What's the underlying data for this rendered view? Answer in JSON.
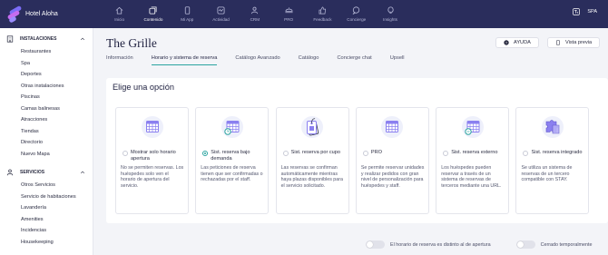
{
  "brand": {
    "name": "Hotel Aloha"
  },
  "nav": [
    {
      "label": "Inicio",
      "icon": "home-icon",
      "active": false
    },
    {
      "label": "Contenido",
      "icon": "content-icon",
      "active": true
    },
    {
      "label": "Mi App",
      "icon": "phone-icon",
      "active": false
    },
    {
      "label": "Actividad",
      "icon": "activity-icon",
      "active": false
    },
    {
      "label": "CRM",
      "icon": "users-icon",
      "active": false
    },
    {
      "label": "PRO",
      "icon": "pro-icon",
      "active": false
    },
    {
      "label": "Feedback",
      "icon": "thumbs-up-icon",
      "active": false
    },
    {
      "label": "Concierge",
      "icon": "chat-icon",
      "active": false
    },
    {
      "label": "Insights",
      "icon": "lightbulb-icon",
      "active": false
    }
  ],
  "top_right": {
    "lang": "SPA"
  },
  "sidebar": {
    "sections": [
      {
        "title": "INSTALACIONES",
        "items": [
          "Restaurantes",
          "Spa",
          "Deportes",
          "Otras instalaciones",
          "Piscinas",
          "Camas balinesas",
          "Atracciones",
          "Tiendas",
          "Directorio",
          "Nuevo Mapa"
        ]
      },
      {
        "title": "SERVICIOS",
        "items": [
          "Otros Servicios",
          "Servicio de habitaciones",
          "Lavandería",
          "Amenities",
          "Incidencias",
          "Housekeeping"
        ]
      }
    ]
  },
  "page": {
    "title": "The Grille",
    "help_label": "AYUDA",
    "preview_label": "Vista previa",
    "tabs": [
      "Información",
      "Horario y sistema de reserva",
      "Catálogo Avanzado",
      "Catálogo",
      "Concierge chat",
      "Upsell"
    ],
    "active_tab": 1
  },
  "card": {
    "title": "Elige una opción",
    "options": [
      {
        "label": "Mostrar solo horario apertura",
        "desc": "No se permiten reservas. Los huéspedes solo ven el horario de apertura del servicio.",
        "checked": false
      },
      {
        "label": "Sist. reserva bajo demanda",
        "desc": "Las peticiones de reserva tienen que ser confirmadas o rechazadas por el staff.",
        "checked": true
      },
      {
        "label": "Sist. reserva por cupo",
        "desc": "Las reservas se confirman automáticamente mientras haya plazas disponibles para el servicio solicitado.",
        "checked": false
      },
      {
        "label": "PRO",
        "desc": "Se permite reservar unidades y realizar pedidos con gran nivel de personalización para huéspedes y staff.",
        "checked": false
      },
      {
        "label": "Sist. reserva externo",
        "desc": "Los huéspedes pueden reservar a través de un sistema de reservas de terceros mediante una URL.",
        "checked": false
      },
      {
        "label": "Sist. reserva integrado",
        "desc": "Se utiliza un sistema de reservas de un tercero compatible con STAY.",
        "checked": false
      }
    ]
  },
  "toggles": [
    {
      "label": "El horario de reserva es distinto al de apertura",
      "on": false
    },
    {
      "label": "Cerrado temporalmente",
      "on": false
    }
  ],
  "colors": {
    "topbar": "#2a2d5c",
    "accent": "#2ba4a0",
    "calendar": "#8b80f0",
    "puzzle": "#8b80f0"
  }
}
